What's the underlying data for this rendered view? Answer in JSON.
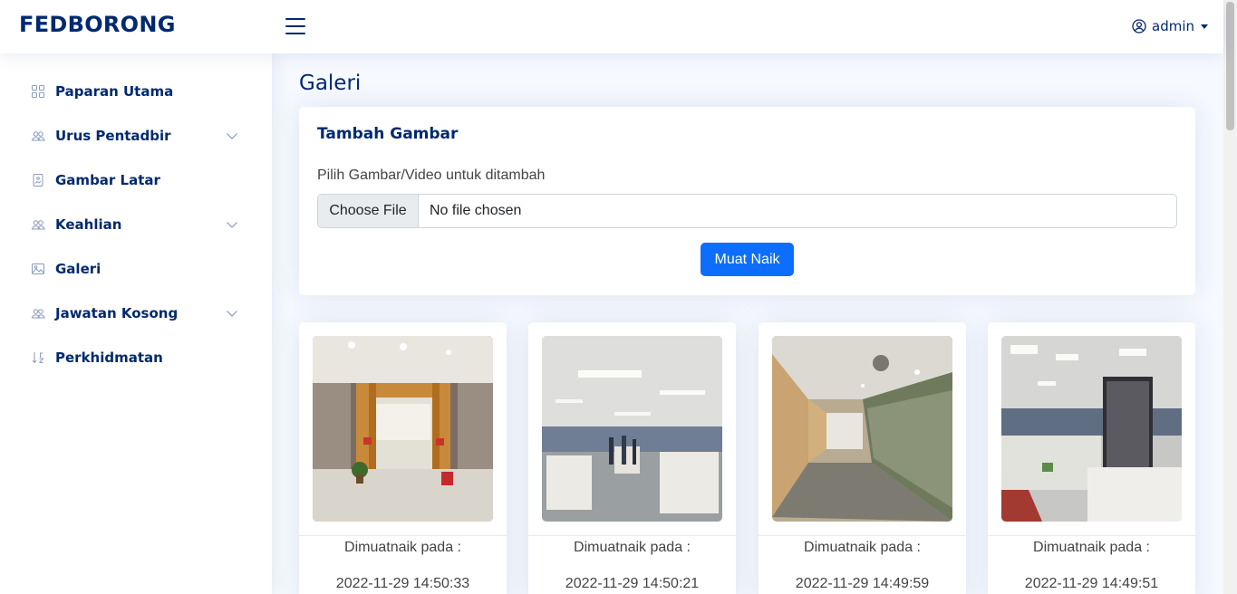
{
  "header": {
    "brand": "FEDBORONG",
    "user_name": "admin"
  },
  "sidebar": {
    "items": [
      {
        "label": "Paparan Utama",
        "icon": "grid-icon",
        "expandable": false
      },
      {
        "label": "Urus Pentadbir",
        "icon": "people-icon",
        "expandable": true
      },
      {
        "label": "Gambar Latar",
        "icon": "file-image-icon",
        "expandable": false
      },
      {
        "label": "Keahlian",
        "icon": "people-icon",
        "expandable": true
      },
      {
        "label": "Galeri",
        "icon": "image-icon",
        "expandable": false
      },
      {
        "label": "Jawatan Kosong",
        "icon": "people-icon",
        "expandable": true
      },
      {
        "label": "Perkhidmatan",
        "icon": "sort-icon",
        "expandable": false
      }
    ]
  },
  "main": {
    "title": "Galeri",
    "upload": {
      "title": "Tambah Gambar",
      "label": "Pilih Gambar/Video untuk ditambah",
      "file_button": "Choose File",
      "file_status": "No file chosen",
      "submit": "Muat Naik"
    },
    "gallery": [
      {
        "caption": "Dimuatnaik pada :",
        "timestamp": "2022-11-29 14:50:33"
      },
      {
        "caption": "Dimuatnaik pada :",
        "timestamp": "2022-11-29 14:50:21"
      },
      {
        "caption": "Dimuatnaik pada :",
        "timestamp": "2022-11-29 14:49:59"
      },
      {
        "caption": "Dimuatnaik pada :",
        "timestamp": "2022-11-29 14:49:51"
      }
    ]
  },
  "colors": {
    "primary": "#0d6efd",
    "navy": "#012970",
    "background": "#f6f9ff"
  }
}
